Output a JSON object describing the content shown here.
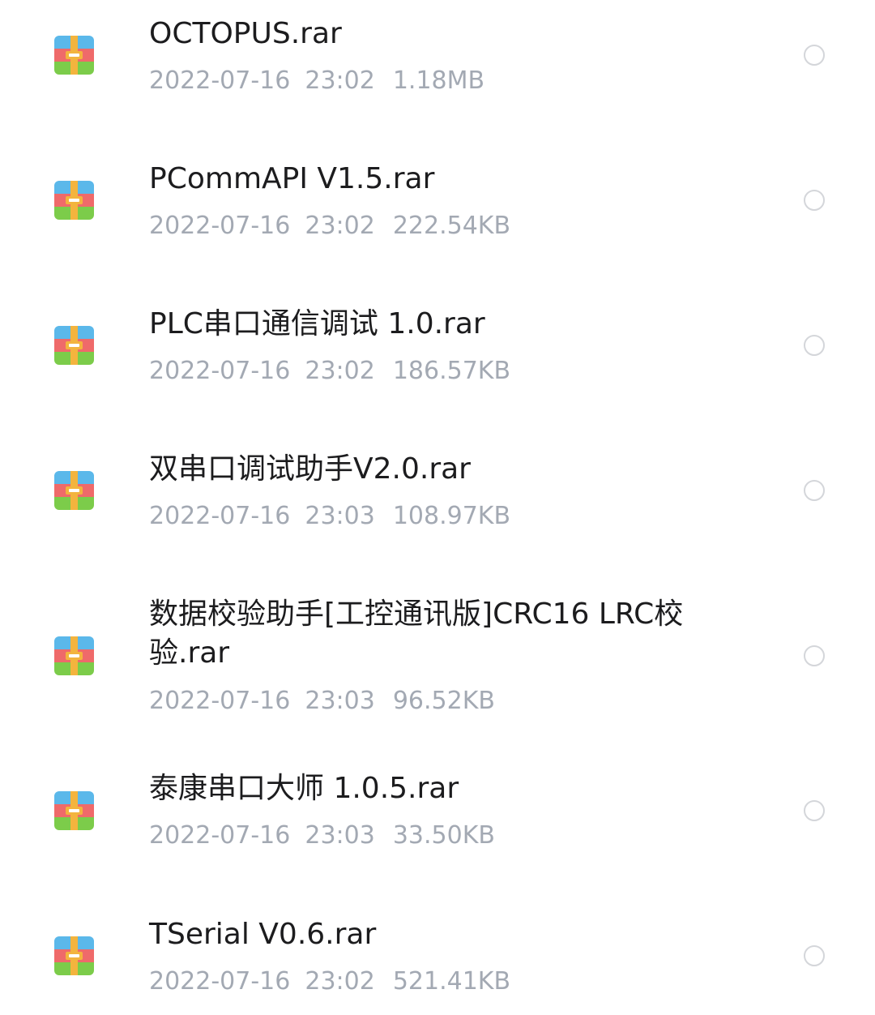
{
  "files": [
    {
      "name": "OCTOPUS.rar",
      "date": "2022-07-16",
      "time": "23:02",
      "size": "1.18MB",
      "icon": "rar-archive-icon"
    },
    {
      "name": "PCommAPI V1.5.rar",
      "date": "2022-07-16",
      "time": "23:02",
      "size": "222.54KB",
      "icon": "rar-archive-icon"
    },
    {
      "name": "PLC串口通信调试 1.0.rar",
      "date": "2022-07-16",
      "time": "23:02",
      "size": "186.57KB",
      "icon": "rar-archive-icon"
    },
    {
      "name": "双串口调试助手V2.0.rar",
      "date": "2022-07-16",
      "time": "23:03",
      "size": "108.97KB",
      "icon": "rar-archive-icon"
    },
    {
      "name": "数据校验助手[工控通讯版]CRC16 LRC校验.rar",
      "date": "2022-07-16",
      "time": "23:03",
      "size": "96.52KB",
      "icon": "rar-archive-icon"
    },
    {
      "name": "泰康串口大师 1.0.5.rar",
      "date": "2022-07-16",
      "time": "23:03",
      "size": "33.50KB",
      "icon": "rar-archive-icon"
    },
    {
      "name": "TSerial V0.6.rar",
      "date": "2022-07-16",
      "time": "23:02",
      "size": "521.41KB",
      "icon": "rar-archive-icon"
    }
  ],
  "colors": {
    "icon_blue": "#5bb8ea",
    "icon_red": "#ef6a6a",
    "icon_green": "#7ccc4a",
    "icon_strap": "#f3b43e",
    "meta_text": "#a3a9b3",
    "radio_border": "#d4d6da"
  }
}
